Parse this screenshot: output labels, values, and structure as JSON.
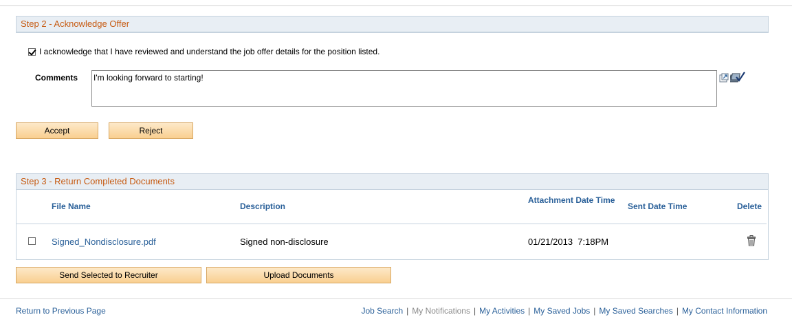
{
  "step2": {
    "header": "Step 2 - Acknowledge Offer",
    "ack_checked": true,
    "ack_text": "I acknowledge that I have reviewed and understand the job offer details for the position listed.",
    "comments_label": "Comments",
    "comments_value": "I'm looking forward to starting!",
    "icons": [
      "expand-icon",
      "spell-check-icon"
    ],
    "buttons": {
      "accept": "Accept",
      "reject": "Reject"
    }
  },
  "step3": {
    "header": "Step 3 - Return Completed Documents",
    "columns": {
      "file_name": "File Name",
      "description": "Description",
      "attachment_date_time": "Attachment Date Time",
      "sent_date_time": "Sent Date Time",
      "delete": "Delete"
    },
    "rows": [
      {
        "selected": false,
        "file_name": "Signed_Nondisclosure.pdf",
        "description": "Signed non-disclosure",
        "attachment_date_time": "01/21/2013  7:18PM",
        "sent_date_time": "",
        "delete_icon": "trash-icon"
      }
    ],
    "buttons": {
      "send": "Send Selected to Recruiter",
      "upload": "Upload Documents"
    }
  },
  "footer": {
    "return_link": "Return to Previous Page",
    "links": {
      "job_search": "Job Search",
      "my_notifications": "My Notifications",
      "my_activities": "My Activities",
      "my_saved_jobs": "My Saved Jobs",
      "my_saved_searches": "My Saved Searches",
      "my_contact_information": "My Contact Information"
    },
    "separator": "|"
  },
  "colors": {
    "section_title": "#c65a11",
    "link": "#2a6099",
    "section_bg": "#e8eef4",
    "button_bg": "#f9cf90"
  }
}
